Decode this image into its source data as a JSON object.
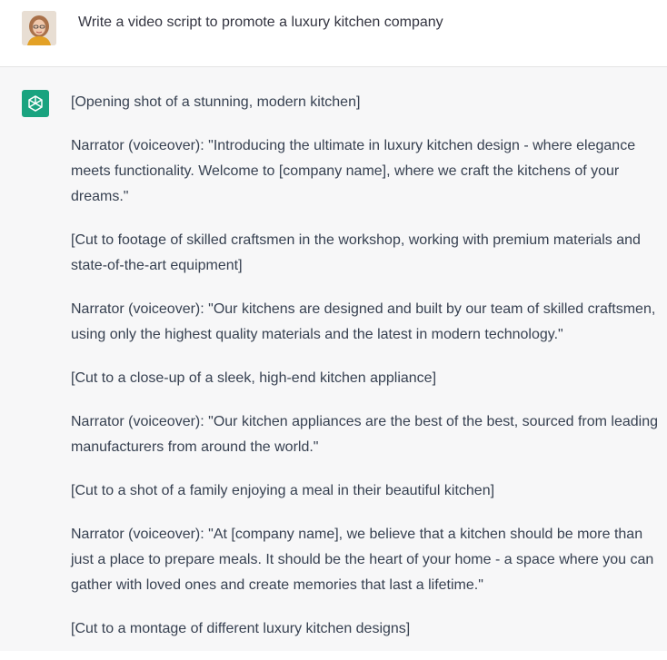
{
  "user_message": {
    "text": "Write a video script to promote a luxury kitchen company",
    "avatar_icon": "user-photo-avatar"
  },
  "assistant_message": {
    "avatar_icon": "openai-logo-icon",
    "avatar_color": "#19a37f",
    "paragraphs": [
      "[Opening shot of a stunning, modern kitchen]",
      "Narrator (voiceover): \"Introducing the ultimate in luxury kitchen design - where elegance meets functionality. Welcome to [company name], where we craft the kitchens of your dreams.\"",
      "[Cut to footage of skilled craftsmen in the workshop, working with premium materials and state-of-the-art equipment]",
      "Narrator (voiceover): \"Our kitchens are designed and built by our team of skilled craftsmen, using only the highest quality materials and the latest in modern technology.\"",
      "[Cut to a close-up of a sleek, high-end kitchen appliance]",
      "Narrator (voiceover): \"Our kitchen appliances are the best of the best, sourced from leading manufacturers from around the world.\"",
      "[Cut to a shot of a family enjoying a meal in their beautiful kitchen]",
      "Narrator (voiceover): \"At [company name], we believe that a kitchen should be more than just a place to prepare meals. It should be the heart of your home - a space where you can gather with loved ones and create memories that last a lifetime.\"",
      "[Cut to a montage of different luxury kitchen designs]"
    ]
  }
}
